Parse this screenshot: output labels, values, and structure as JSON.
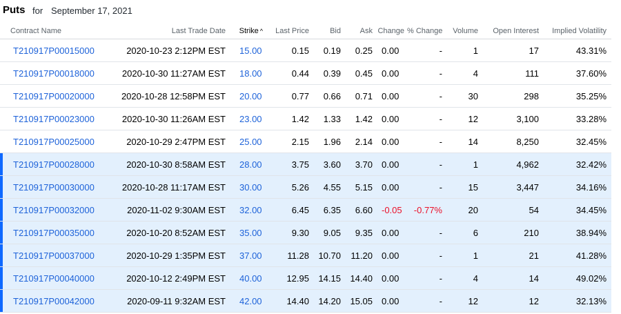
{
  "header": {
    "title": "Puts",
    "for_label": "for",
    "date": "September 17, 2021"
  },
  "columns": {
    "contract_name": "Contract Name",
    "last_trade_date": "Last Trade Date",
    "strike": "Strike",
    "last_price": "Last Price",
    "bid": "Bid",
    "ask": "Ask",
    "change": "Change",
    "pct_change": "% Change",
    "volume": "Volume",
    "open_interest": "Open Interest",
    "implied_volatility": "Implied Volatility"
  },
  "colors": {
    "link": "#1d62d9",
    "negative": "#eb0f29",
    "in_the_money_row": "#e3f0fd",
    "in_the_money_marker": "#0f69ff"
  },
  "rows": [
    {
      "contract": "T210917P00015000",
      "last_trade": "2020-10-23 2:12PM EST",
      "strike": "15.00",
      "last_price": "0.15",
      "bid": "0.19",
      "ask": "0.25",
      "change": "0.00",
      "pct_change": "-",
      "volume": "1",
      "open_interest": "17",
      "iv": "43.31%",
      "itm": false,
      "negative": false
    },
    {
      "contract": "T210917P00018000",
      "last_trade": "2020-10-30 11:27AM EST",
      "strike": "18.00",
      "last_price": "0.44",
      "bid": "0.39",
      "ask": "0.45",
      "change": "0.00",
      "pct_change": "-",
      "volume": "4",
      "open_interest": "111",
      "iv": "37.60%",
      "itm": false,
      "negative": false
    },
    {
      "contract": "T210917P00020000",
      "last_trade": "2020-10-28 12:58PM EST",
      "strike": "20.00",
      "last_price": "0.77",
      "bid": "0.66",
      "ask": "0.71",
      "change": "0.00",
      "pct_change": "-",
      "volume": "30",
      "open_interest": "298",
      "iv": "35.25%",
      "itm": false,
      "negative": false
    },
    {
      "contract": "T210917P00023000",
      "last_trade": "2020-10-30 11:26AM EST",
      "strike": "23.00",
      "last_price": "1.42",
      "bid": "1.33",
      "ask": "1.42",
      "change": "0.00",
      "pct_change": "-",
      "volume": "12",
      "open_interest": "3,100",
      "iv": "33.28%",
      "itm": false,
      "negative": false
    },
    {
      "contract": "T210917P00025000",
      "last_trade": "2020-10-29 2:47PM EST",
      "strike": "25.00",
      "last_price": "2.15",
      "bid": "1.96",
      "ask": "2.14",
      "change": "0.00",
      "pct_change": "-",
      "volume": "14",
      "open_interest": "8,250",
      "iv": "32.45%",
      "itm": false,
      "negative": false
    },
    {
      "contract": "T210917P00028000",
      "last_trade": "2020-10-30 8:58AM EST",
      "strike": "28.00",
      "last_price": "3.75",
      "bid": "3.60",
      "ask": "3.70",
      "change": "0.00",
      "pct_change": "-",
      "volume": "1",
      "open_interest": "4,962",
      "iv": "32.42%",
      "itm": true,
      "negative": false
    },
    {
      "contract": "T210917P00030000",
      "last_trade": "2020-10-28 11:17AM EST",
      "strike": "30.00",
      "last_price": "5.26",
      "bid": "4.55",
      "ask": "5.15",
      "change": "0.00",
      "pct_change": "-",
      "volume": "15",
      "open_interest": "3,447",
      "iv": "34.16%",
      "itm": true,
      "negative": false
    },
    {
      "contract": "T210917P00032000",
      "last_trade": "2020-11-02 9:30AM EST",
      "strike": "32.00",
      "last_price": "6.45",
      "bid": "6.35",
      "ask": "6.60",
      "change": "-0.05",
      "pct_change": "-0.77%",
      "volume": "20",
      "open_interest": "54",
      "iv": "34.45%",
      "itm": true,
      "negative": true
    },
    {
      "contract": "T210917P00035000",
      "last_trade": "2020-10-20 8:52AM EST",
      "strike": "35.00",
      "last_price": "9.30",
      "bid": "9.05",
      "ask": "9.35",
      "change": "0.00",
      "pct_change": "-",
      "volume": "6",
      "open_interest": "210",
      "iv": "38.94%",
      "itm": true,
      "negative": false
    },
    {
      "contract": "T210917P00037000",
      "last_trade": "2020-10-29 1:35PM EST",
      "strike": "37.00",
      "last_price": "11.28",
      "bid": "10.70",
      "ask": "11.20",
      "change": "0.00",
      "pct_change": "-",
      "volume": "1",
      "open_interest": "21",
      "iv": "41.28%",
      "itm": true,
      "negative": false
    },
    {
      "contract": "T210917P00040000",
      "last_trade": "2020-10-12 2:49PM EST",
      "strike": "40.00",
      "last_price": "12.95",
      "bid": "14.15",
      "ask": "14.40",
      "change": "0.00",
      "pct_change": "-",
      "volume": "4",
      "open_interest": "14",
      "iv": "49.02%",
      "itm": true,
      "negative": false
    },
    {
      "contract": "T210917P00042000",
      "last_trade": "2020-09-11 9:32AM EST",
      "strike": "42.00",
      "last_price": "14.40",
      "bid": "14.20",
      "ask": "15.05",
      "change": "0.00",
      "pct_change": "-",
      "volume": "12",
      "open_interest": "12",
      "iv": "32.13%",
      "itm": true,
      "negative": false
    }
  ]
}
